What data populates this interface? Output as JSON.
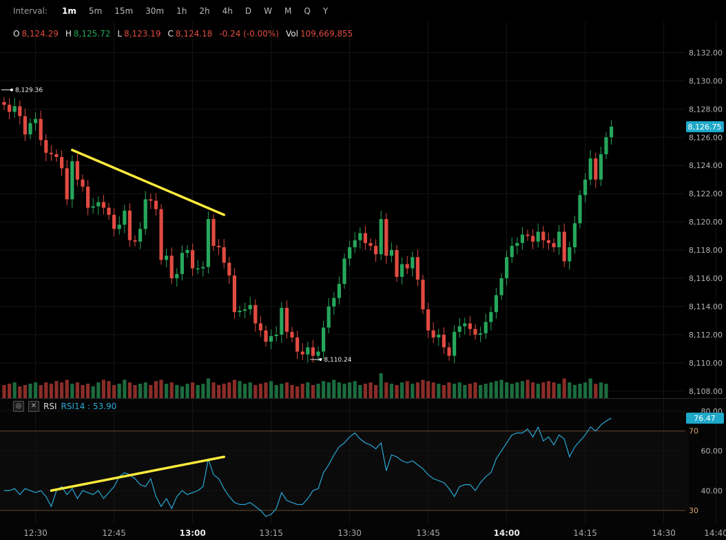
{
  "toolbar": {
    "interval_label": "Interval:",
    "intervals": [
      "1m",
      "5m",
      "15m",
      "30m",
      "1h",
      "2h",
      "4h",
      "D",
      "W",
      "M",
      "Q",
      "Y"
    ],
    "active": "1m"
  },
  "ohlc": {
    "o_label": "O",
    "o": "8,124.29",
    "h_label": "H",
    "h": "8,125.72",
    "l_label": "L",
    "l": "8,123.19",
    "c_label": "C",
    "c": "8,124.18",
    "change": "-0.24 (-0.00%)",
    "vol_label": "Vol",
    "vol": "109,669,855"
  },
  "rsi_header": {
    "name": "RSI",
    "label": "RSI14 : 53.90"
  },
  "colors": {
    "up": "#26a65b",
    "down": "#e04b41",
    "rsi": "#2aa8d8",
    "trend": "#ffeb3b",
    "price_tag": "#1fa9c9"
  },
  "chart_data": {
    "type": "candlestick",
    "y_ticks": [
      "8,132.00",
      "8,130.00",
      "8,128.00",
      "8,126.00",
      "8,124.00",
      "8,122.00",
      "8,120.00",
      "8,118.00",
      "8,116.00",
      "8,114.00",
      "8,112.00",
      "8,110.00",
      "8,108.00"
    ],
    "y_tick_values": [
      8132,
      8130,
      8128,
      8126,
      8124,
      8122,
      8120,
      8118,
      8116,
      8114,
      8112,
      8110,
      8108
    ],
    "ylim": [
      8107.5,
      8133
    ],
    "x_ticks": [
      {
        "label": "12:30",
        "min": 6,
        "bold": false
      },
      {
        "label": "12:45",
        "min": 21,
        "bold": false
      },
      {
        "label": "13:00",
        "min": 36,
        "bold": true
      },
      {
        "label": "13:15",
        "min": 51,
        "bold": false
      },
      {
        "label": "13:30",
        "min": 66,
        "bold": false
      },
      {
        "label": "13:45",
        "min": 81,
        "bold": false
      },
      {
        "label": "14:00",
        "min": 96,
        "bold": true
      },
      {
        "label": "14:15",
        "min": 111,
        "bold": false
      },
      {
        "label": "14:30",
        "min": 126,
        "bold": false
      },
      {
        "label": "14:40",
        "min": 136,
        "bold": false
      }
    ],
    "close": [
      8128.3,
      8127.8,
      8128.2,
      8127.5,
      8126.2,
      8127.0,
      8127.3,
      8125.8,
      8124.9,
      8124.8,
      8124.6,
      8123.8,
      8121.6,
      8124.3,
      8123.0,
      8122.5,
      8121.0,
      8121.1,
      8121.4,
      8121.0,
      8120.5,
      8119.5,
      8119.8,
      8120.8,
      8118.7,
      8118.6,
      8119.5,
      8121.6,
      8121.5,
      8120.9,
      8117.3,
      8117.6,
      8116.0,
      8116.3,
      8117.8,
      8118.0,
      8116.7,
      8116.7,
      8116.8,
      8120.2,
      8118.3,
      8118.2,
      8117.1,
      8116.2,
      8113.6,
      8113.7,
      8113.8,
      8114.1,
      8112.8,
      8112.3,
      8111.5,
      8111.9,
      8112.0,
      8113.9,
      8112.2,
      8111.8,
      8110.8,
      8110.6,
      8111.1,
      8110.5,
      8110.8,
      8112.5,
      8114.0,
      8114.6,
      8115.6,
      8117.4,
      8118.2,
      8118.7,
      8119.2,
      8118.5,
      8118.3,
      8117.7,
      8120.2,
      8117.6,
      8118.0,
      8116.1,
      8117.0,
      8116.7,
      8117.5,
      8115.9,
      8113.8,
      8112.3,
      8111.8,
      8112.0,
      8111.1,
      8110.5,
      8112.2,
      8112.6,
      8112.8,
      8112.4,
      8112.0,
      8112.1,
      8112.9,
      8113.6,
      8114.8,
      8116.0,
      8117.5,
      8118.3,
      8118.5,
      8119.1,
      8119.0,
      8118.6,
      8119.3,
      8118.7,
      8118.5,
      8118.2,
      8119.3,
      8117.2,
      8118.2,
      8119.9,
      8121.9,
      8123.0,
      8124.5,
      8123.0,
      8124.8,
      8126.0,
      8126.75
    ],
    "volume": [
      0.5,
      0.55,
      0.6,
      0.45,
      0.5,
      0.55,
      0.6,
      0.5,
      0.6,
      0.55,
      0.65,
      0.6,
      0.7,
      0.55,
      0.6,
      0.5,
      0.55,
      0.45,
      0.6,
      0.7,
      0.65,
      0.5,
      0.55,
      0.7,
      0.6,
      0.5,
      0.55,
      0.6,
      0.5,
      0.65,
      0.7,
      0.55,
      0.6,
      0.5,
      0.45,
      0.55,
      0.6,
      0.5,
      0.55,
      0.75,
      0.6,
      0.5,
      0.55,
      0.6,
      0.7,
      0.65,
      0.55,
      0.6,
      0.5,
      0.55,
      0.6,
      0.65,
      0.5,
      0.55,
      0.6,
      0.5,
      0.45,
      0.55,
      0.6,
      0.5,
      0.55,
      0.65,
      0.6,
      0.7,
      0.6,
      0.55,
      0.6,
      0.65,
      0.5,
      0.55,
      0.6,
      0.5,
      0.95,
      0.6,
      0.55,
      0.5,
      0.6,
      0.65,
      0.55,
      0.6,
      0.7,
      0.65,
      0.6,
      0.55,
      0.5,
      0.6,
      0.55,
      0.6,
      0.5,
      0.55,
      0.6,
      0.5,
      0.55,
      0.6,
      0.65,
      0.7,
      0.6,
      0.55,
      0.6,
      0.65,
      0.7,
      0.6,
      0.55,
      0.6,
      0.65,
      0.6,
      0.55,
      0.75,
      0.6,
      0.5,
      0.55,
      0.6,
      0.75,
      0.55,
      0.6,
      0.55
    ],
    "annotations": [
      {
        "label": "8,129.36",
        "min": 0,
        "value": 8129.36
      },
      {
        "label": "8,110.24",
        "min": 59,
        "value": 8110.24
      }
    ],
    "last_price": {
      "label": "8,126.75",
      "value": 8126.75
    },
    "trendline_price": {
      "from": {
        "min": 13,
        "value": 8125.1
      },
      "to": {
        "min": 42,
        "value": 8120.5
      }
    },
    "rsi": {
      "y_ticks": [
        "80.00",
        "70",
        "60.00",
        "40.00",
        "30"
      ],
      "y_tick_values": [
        80,
        70,
        60,
        40,
        30
      ],
      "highlight_levels": [
        70,
        30
      ],
      "ylim": [
        29,
        81
      ],
      "last": {
        "label": "76.47",
        "value": 76.47
      },
      "values": [
        40,
        40,
        41,
        38,
        41,
        40,
        39,
        40,
        37,
        32,
        40,
        42,
        38,
        41,
        36,
        40,
        39,
        38,
        40,
        36,
        39,
        42,
        47,
        49,
        48,
        46,
        43,
        42,
        46,
        37,
        32,
        36,
        31,
        37,
        40,
        38,
        39,
        40,
        42,
        56,
        48,
        46,
        41,
        37,
        34,
        33,
        33,
        34,
        32,
        30,
        27,
        28,
        31,
        39,
        35,
        34,
        33,
        33,
        36,
        40,
        41,
        49,
        53,
        58,
        62,
        64,
        67,
        69,
        66,
        64,
        63,
        61,
        64,
        50,
        58,
        57,
        55,
        54,
        55,
        53,
        51,
        48,
        46,
        45,
        44,
        41,
        37,
        42,
        43,
        43,
        40,
        44,
        47,
        49,
        56,
        60,
        64,
        68,
        69,
        69,
        71,
        67,
        72,
        65,
        67,
        63,
        68,
        66,
        57,
        62,
        65,
        68,
        72,
        70,
        73,
        75,
        76.47
      ],
      "trendline": {
        "from": {
          "min": 9,
          "value": 40
        },
        "to": {
          "min": 42,
          "value": 57
        }
      }
    }
  }
}
